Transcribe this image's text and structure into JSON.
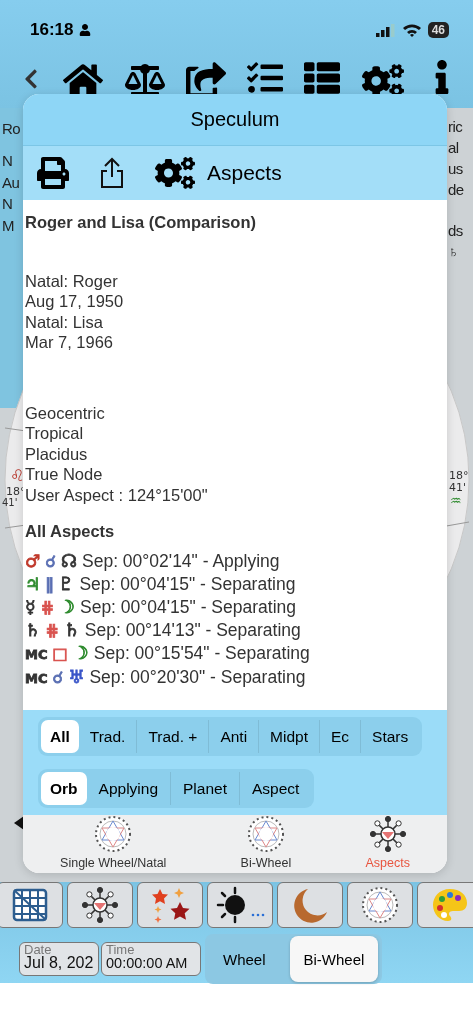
{
  "status_bar": {
    "time": "16:18",
    "battery": "46"
  },
  "background": {
    "left_fragments": [
      "Ro",
      "N",
      "Au",
      "N",
      "M"
    ],
    "right_fragments": [
      "ric",
      "al",
      "us",
      "de",
      "ds",
      "♄"
    ],
    "wheel_left": [
      "♌",
      "18°",
      "41'"
    ],
    "wheel_right": [
      "18°",
      "41'",
      "♒"
    ]
  },
  "modal": {
    "title": "Speculum",
    "toolbar_label": "Aspects",
    "report": {
      "title": "Roger and Lisa (Comparison)",
      "charts": [
        "Natal: Roger",
        "Aug 17, 1950",
        "Natal: Lisa",
        "Mar 7, 1966"
      ],
      "settings": [
        "Geocentric",
        "Tropical",
        "Placidus",
        "True Node",
        "User Aspect : 124°15'00\""
      ],
      "section_title": "All Aspects",
      "aspects": [
        {
          "p1": {
            "symbol": "♂",
            "color": "#c0392b"
          },
          "aspect": {
            "symbol": "☌",
            "color": "#5a6fb3"
          },
          "p2": {
            "symbol": "☊",
            "color": "#333333"
          },
          "text": "Sep: 00°02'14\" - Applying"
        },
        {
          "p1": {
            "symbol": "♃",
            "color": "#2e8b2e"
          },
          "aspect": {
            "symbol": "∥",
            "color": "#5a6fb3"
          },
          "p2": {
            "symbol": "♇",
            "color": "#333333"
          },
          "text": "Sep: 00°04'15\" - Separating"
        },
        {
          "p1": {
            "symbol": "☿",
            "color": "#333333"
          },
          "aspect": {
            "symbol": "⋕",
            "color": "#d9534f"
          },
          "p2": {
            "symbol": "☽",
            "color": "#2e8b2e"
          },
          "text": "Sep: 00°04'15\" - Separating"
        },
        {
          "p1": {
            "symbol": "♄",
            "color": "#333333"
          },
          "aspect": {
            "symbol": "⋕",
            "color": "#d9534f"
          },
          "p2": {
            "symbol": "♄",
            "color": "#333333"
          },
          "text": "Sep: 00°14'13\" - Separating"
        },
        {
          "p1": {
            "symbol": "MC",
            "color": "#333333"
          },
          "aspect": {
            "symbol": "□",
            "color": "#d9534f"
          },
          "p2": {
            "symbol": "☽",
            "color": "#2e8b2e"
          },
          "text": "Sep: 00°15'54\" - Separating"
        },
        {
          "p1": {
            "symbol": "MC",
            "color": "#333333"
          },
          "aspect": {
            "symbol": "☌",
            "color": "#5a6fb3"
          },
          "p2": {
            "symbol": "♅",
            "color": "#3a55c8"
          },
          "text": "Sep: 00°20'30\" - Separating"
        }
      ]
    },
    "filters": [
      {
        "label": "All",
        "selected": true
      },
      {
        "label": "Trad.",
        "selected": false
      },
      {
        "label": "Trad. +",
        "selected": false
      },
      {
        "label": "Anti",
        "selected": false
      },
      {
        "label": "Midpt",
        "selected": false
      },
      {
        "label": "Ec",
        "selected": false
      },
      {
        "label": "Stars",
        "selected": false
      }
    ],
    "sort": [
      {
        "label": "Orb",
        "selected": true
      },
      {
        "label": "Applying",
        "selected": false
      },
      {
        "label": "Planet",
        "selected": false
      },
      {
        "label": "Aspect",
        "selected": false
      }
    ],
    "tabs": [
      {
        "label": "Single Wheel/Natal",
        "kind": "wheel",
        "selected": false
      },
      {
        "label": "Bi-Wheel",
        "kind": "wheel",
        "selected": false
      },
      {
        "label": "Aspects",
        "kind": "network",
        "selected": true
      }
    ]
  },
  "date_field": {
    "label": "Date",
    "value": "Jul 8, 202"
  },
  "time_field": {
    "label": "Time",
    "value": "00:00:00 AM"
  },
  "view_switch": [
    {
      "label": "Wheel",
      "selected": false
    },
    {
      "label": "Bi-Wheel",
      "selected": true
    }
  ]
}
